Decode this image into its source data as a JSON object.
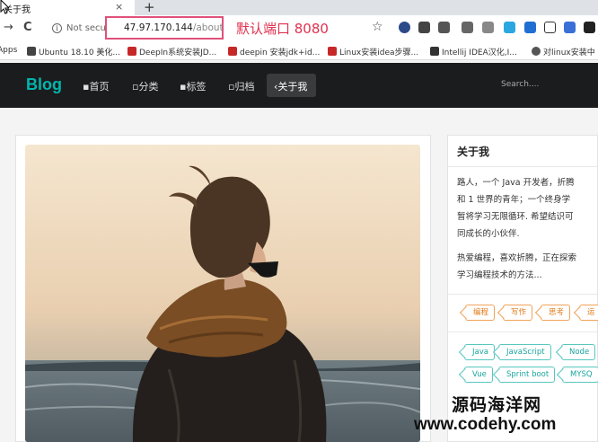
{
  "browser": {
    "tab_title": "关于我",
    "tab_close": "×",
    "new_tab": "+",
    "back": "→",
    "reload": "C",
    "not_secure": "Not secure",
    "url_host": "47.97.170.144",
    "url_path": "/about",
    "annotation": "默认端口 8080",
    "star": "☆"
  },
  "bookmarks": [
    {
      "label": "Apps",
      "color": ""
    },
    {
      "label": "Ubuntu 18.10 美化...",
      "color": "#444444"
    },
    {
      "label": "DeepIn系统安装JD...",
      "color": "#c62828"
    },
    {
      "label": "deepin 安装jdk+id...",
      "color": "#c62828"
    },
    {
      "label": "Linux安装idea步骤...",
      "color": "#c62828"
    },
    {
      "label": "Intellij IDEA汉化,I...",
      "color": "#333333"
    },
    {
      "label": "对linux安装中",
      "color": "#555555"
    }
  ],
  "site": {
    "logo": "Blog",
    "nav": [
      "首页",
      "分类",
      "标签",
      "归档",
      "关于我"
    ],
    "active_nav": "关于我",
    "search_placeholder": "Search....",
    "accent": "#00b5ad"
  },
  "about": {
    "title": "关于我",
    "lines_1": [
      "路人，一个 Java 开发者，折腾",
      "和 1 世界的青年；一个终身学",
      "暂将学习无限循环. 希望结识可",
      "同成长的小伙伴."
    ],
    "lines_2": [
      "热爱编程，喜欢折腾，正在探索",
      "学习编程技术的方法..."
    ],
    "hobby_tags": [
      "编程",
      "写作",
      "思考",
      "运"
    ],
    "tech_tags_row1": [
      "Java",
      "JavaScript",
      "Node"
    ],
    "tech_tags_row2": [
      "Vue",
      "Sprint boot",
      "MYSQ"
    ]
  },
  "watermark": {
    "line1": "源码海洋网",
    "line2": "www.codehy.com"
  }
}
